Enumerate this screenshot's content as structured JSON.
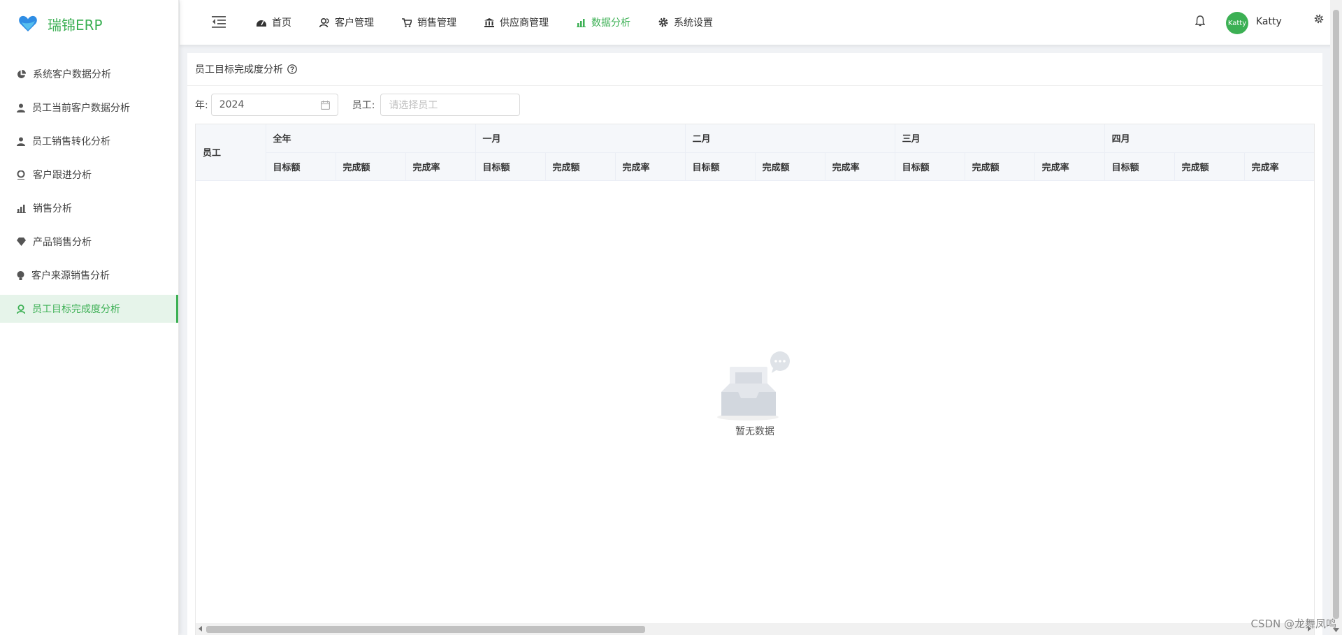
{
  "app": {
    "title": "瑞锦ERP",
    "brand_color": "#3cb054"
  },
  "sidebar": {
    "items": [
      {
        "label": "系统客户数据分析",
        "icon": "pie-chart-icon"
      },
      {
        "label": "员工当前客户数据分析",
        "icon": "user-icon"
      },
      {
        "label": "员工销售转化分析",
        "icon": "user-icon"
      },
      {
        "label": "客户跟进分析",
        "icon": "user-follow-icon"
      },
      {
        "label": "销售分析",
        "icon": "bar-chart-icon"
      },
      {
        "label": "产品销售分析",
        "icon": "diamond-icon"
      },
      {
        "label": "客户来源销售分析",
        "icon": "bulb-icon"
      },
      {
        "label": "员工目标完成度分析",
        "icon": "target-user-icon",
        "active": true
      }
    ]
  },
  "header": {
    "nav": [
      {
        "label": "首页",
        "icon": "dashboard-icon"
      },
      {
        "label": "客户管理",
        "icon": "users-icon"
      },
      {
        "label": "销售管理",
        "icon": "cart-icon"
      },
      {
        "label": "供应商管理",
        "icon": "bank-icon"
      },
      {
        "label": "数据分析",
        "icon": "bar-chart-icon",
        "active": true
      },
      {
        "label": "系统设置",
        "icon": "gear-icon"
      }
    ],
    "avatar_text": "Katty",
    "username": "Katty"
  },
  "page": {
    "title": "员工目标完成度分析",
    "filters": {
      "year_label": "年:",
      "year_value": "2024",
      "employee_label": "员工:",
      "employee_placeholder": "请选择员工"
    },
    "table": {
      "employee_header": "员工",
      "groups": [
        "全年",
        "一月",
        "二月",
        "三月",
        "四月"
      ],
      "sub_headers": [
        "目标额",
        "完成额",
        "完成率"
      ]
    },
    "empty_text": "暂无数据"
  },
  "watermark": "CSDN @龙舞凤鸣"
}
